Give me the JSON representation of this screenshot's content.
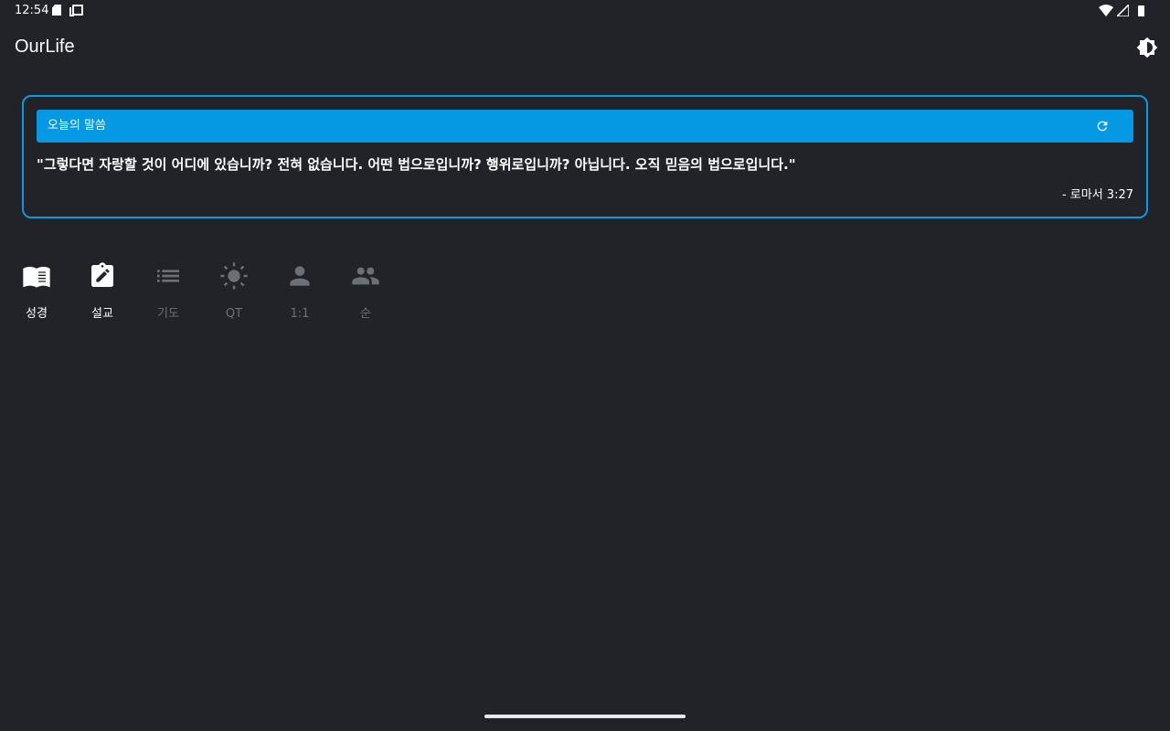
{
  "status_bar": {
    "time": "12:54",
    "left_icons": [
      "sd-card-icon",
      "window-icon"
    ],
    "right_icons": [
      "wifi-icon",
      "cellular-icon",
      "battery-icon"
    ]
  },
  "app_bar": {
    "title": "OurLife",
    "action_icon": "brightness-icon"
  },
  "verse_card": {
    "header_title": "오늘의 말씀",
    "refresh_icon": "refresh-icon",
    "text": "\"그렇다면 자랑할 것이 어디에 있습니까? 전혀 없습니다. 어떤 법으로입니까? 행위로입니까? 아닙니다. 오직 믿음의 법으로입니다.\"",
    "reference": "- 로마서 3:27"
  },
  "features": [
    {
      "label": "성경",
      "icon": "book-icon",
      "active": true
    },
    {
      "label": "설교",
      "icon": "assignment-edit-icon",
      "active": true
    },
    {
      "label": "기도",
      "icon": "list-icon",
      "active": false
    },
    {
      "label": "QT",
      "icon": "sun-icon",
      "active": false
    },
    {
      "label": "1:1",
      "icon": "person-icon",
      "active": false
    },
    {
      "label": "순",
      "icon": "people-icon",
      "active": false
    }
  ],
  "colors": {
    "background": "#212329",
    "accent": "#0599e3",
    "card_border": "#0a97e4",
    "active_label": "#ffffff",
    "inactive": "#6b6f77"
  }
}
